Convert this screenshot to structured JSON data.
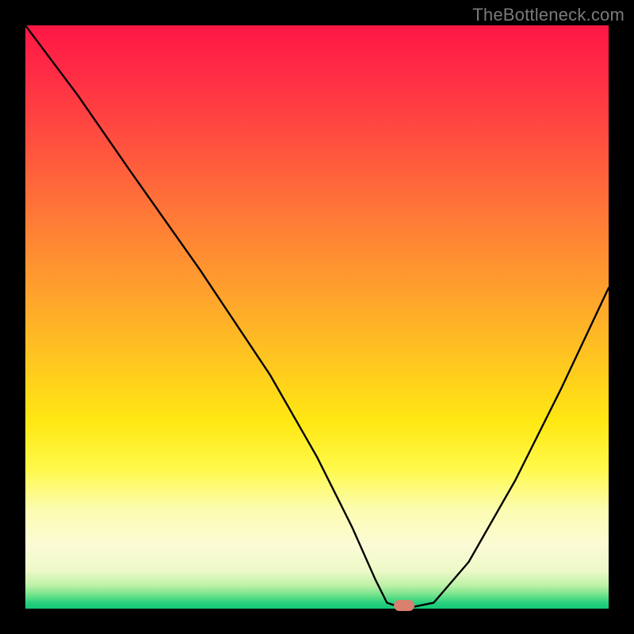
{
  "watermark": "TheBottleneck.com",
  "chart_data": {
    "type": "line",
    "title": "",
    "xlabel": "",
    "ylabel": "",
    "xlim": [
      0,
      100
    ],
    "ylim": [
      0,
      100
    ],
    "series": [
      {
        "name": "bottleneck-curve",
        "x": [
          0,
          9,
          18,
          30,
          42,
          50,
          56,
          60,
          62,
          65,
          70,
          76,
          84,
          92,
          100
        ],
        "values": [
          100,
          88,
          75,
          58,
          40,
          26,
          14,
          5,
          1,
          0,
          1,
          8,
          22,
          38,
          55
        ]
      }
    ],
    "marker": {
      "x": 65,
      "y": 0,
      "name": "optimal-point"
    },
    "colors": {
      "background_top": "#ff1745",
      "background_bottom": "#14c878",
      "curve": "#000000",
      "marker": "#d9806e",
      "frame": "#000000"
    }
  }
}
